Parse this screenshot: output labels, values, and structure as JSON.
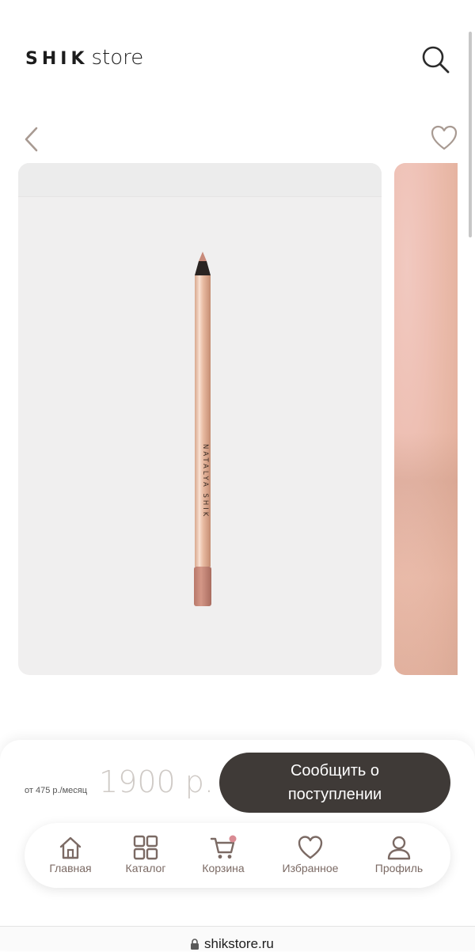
{
  "header": {
    "logo_bold": "SHIK",
    "logo_light": "store"
  },
  "product": {
    "brand_on_pencil": "NATALYA SHIK",
    "price": "1900 р.",
    "monthly": "от 475 р./месяц",
    "notify_label": "Сообщить о поступлении"
  },
  "tabs": [
    {
      "label": "Главная",
      "icon": "home-icon"
    },
    {
      "label": "Каталог",
      "icon": "catalog-icon"
    },
    {
      "label": "Корзина",
      "icon": "cart-icon"
    },
    {
      "label": "Избранное",
      "icon": "heart-icon"
    },
    {
      "label": "Профиль",
      "icon": "profile-icon"
    }
  ],
  "browser": {
    "url": "shikstore.ru"
  },
  "colors": {
    "accent": "#7b6a64",
    "button_dark": "#3f3a37",
    "price_grey": "#cfcac6",
    "cart_dot": "#d98b93"
  }
}
